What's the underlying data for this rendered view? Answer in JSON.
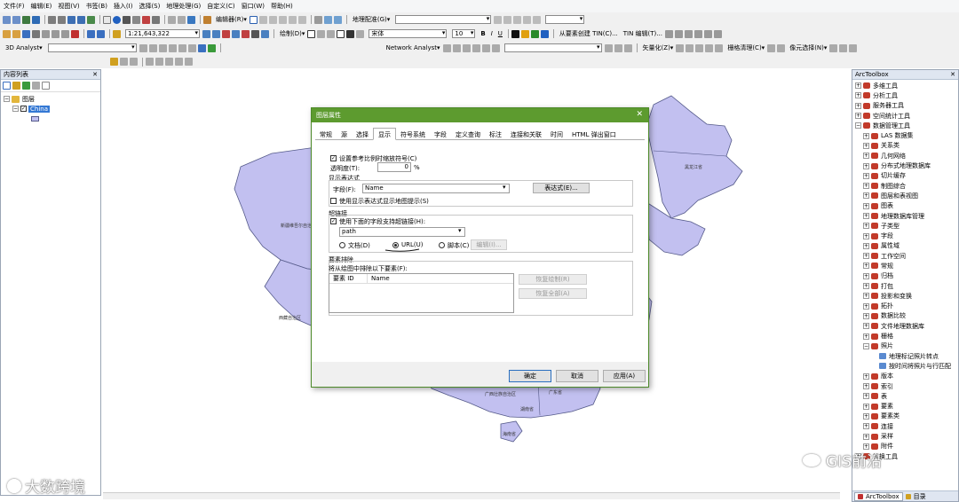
{
  "menu": [
    "文件(F)",
    "编辑(E)",
    "视图(V)",
    "书签(B)",
    "插入(I)",
    "选择(S)",
    "地理处理(G)",
    "自定义(C)",
    "窗口(W)",
    "帮助(H)"
  ],
  "toolbar1": {
    "editor_label": "编辑器(R)▾",
    "georef_label": "地理配准(G)▾"
  },
  "toolbar2": {
    "scale": "1:21,643,322",
    "draw_label": "绘制(D)▾",
    "font": "宋体",
    "font_size": "10",
    "bold": "B",
    "italic": "I",
    "underline": "U",
    "tin_from_features": "从要素创建 TIN(C)...",
    "tin_editing": "TIN 编辑(T)..."
  },
  "toolbar3": {
    "analyst_3d": "3D Analyst▾",
    "network_analyst": "Network Analyst▾",
    "vectorize": "矢量化(Z)▾",
    "raster_cleanup": "栅格清理(C)▾",
    "cell_select": "像元选择(N)▾"
  },
  "toc": {
    "title": "内容列表",
    "layers_label": "图层",
    "layer_name": "China"
  },
  "toolbox": {
    "title": "ArcToolbox",
    "items": [
      {
        "label": "多维工具",
        "level": 0,
        "exp": "+"
      },
      {
        "label": "分析工具",
        "level": 0,
        "exp": "+"
      },
      {
        "label": "服务器工具",
        "level": 0,
        "exp": "+"
      },
      {
        "label": "空间统计工具",
        "level": 0,
        "exp": "+"
      },
      {
        "label": "数据管理工具",
        "level": 0,
        "exp": "-"
      },
      {
        "label": "LAS 数据集",
        "level": 1,
        "exp": "+"
      },
      {
        "label": "关系类",
        "level": 1,
        "exp": "+"
      },
      {
        "label": "几何网络",
        "level": 1,
        "exp": "+"
      },
      {
        "label": "分布式地理数据库",
        "level": 1,
        "exp": "+"
      },
      {
        "label": "切片缓存",
        "level": 1,
        "exp": "+"
      },
      {
        "label": "制图综合",
        "level": 1,
        "exp": "+"
      },
      {
        "label": "图层和表视图",
        "level": 1,
        "exp": "+"
      },
      {
        "label": "图表",
        "level": 1,
        "exp": "+"
      },
      {
        "label": "地理数据库管理",
        "level": 1,
        "exp": "+"
      },
      {
        "label": "子类型",
        "level": 1,
        "exp": "+"
      },
      {
        "label": "字段",
        "level": 1,
        "exp": "+"
      },
      {
        "label": "属性域",
        "level": 1,
        "exp": "+"
      },
      {
        "label": "工作空间",
        "level": 1,
        "exp": "+"
      },
      {
        "label": "常规",
        "level": 1,
        "exp": "+"
      },
      {
        "label": "归档",
        "level": 1,
        "exp": "+"
      },
      {
        "label": "打包",
        "level": 1,
        "exp": "+"
      },
      {
        "label": "投影和变换",
        "level": 1,
        "exp": "+"
      },
      {
        "label": "拓扑",
        "level": 1,
        "exp": "+"
      },
      {
        "label": "数据比较",
        "level": 1,
        "exp": "+"
      },
      {
        "label": "文件地理数据库",
        "level": 1,
        "exp": "+"
      },
      {
        "label": "栅格",
        "level": 1,
        "exp": "+"
      },
      {
        "label": "照片",
        "level": 1,
        "exp": "-"
      },
      {
        "label": "地理标记照片转点",
        "level": 2,
        "exp": ""
      },
      {
        "label": "按时间将照片与行匹配",
        "level": 2,
        "exp": ""
      },
      {
        "label": "版本",
        "level": 1,
        "exp": "+"
      },
      {
        "label": "索引",
        "level": 1,
        "exp": "+"
      },
      {
        "label": "表",
        "level": 1,
        "exp": "+"
      },
      {
        "label": "要素",
        "level": 1,
        "exp": "+"
      },
      {
        "label": "要素类",
        "level": 1,
        "exp": "+"
      },
      {
        "label": "连接",
        "level": 1,
        "exp": "+"
      },
      {
        "label": "采样",
        "level": 1,
        "exp": "+"
      },
      {
        "label": "附件",
        "level": 1,
        "exp": "+"
      },
      {
        "label": "转换工具",
        "level": 0,
        "exp": "+"
      }
    ],
    "tab_toolbox": "ArcToolbox",
    "tab_catalog": "目录"
  },
  "map_labels": [
    "黑龙江省",
    "新疆维吾尔自治区",
    "西藏自治区",
    "广东省",
    "广西壮族自治区",
    "海南省",
    "湖南省"
  ],
  "dialog": {
    "title": "图层属性",
    "close": "✕",
    "tabs": [
      "常规",
      "源",
      "选择",
      "显示",
      "符号系统",
      "字段",
      "定义查询",
      "标注",
      "连接和关联",
      "时间",
      "HTML 弹出窗口"
    ],
    "active_tab": "显示",
    "scale_symbols": "设置参考比例时缩放符号(C)",
    "transparency_label": "透明度(T):",
    "transparency_value": "0",
    "percent": "%",
    "display_expr_group": "显示表达式",
    "field_label": "字段(F):",
    "field_value": "Name",
    "expression_btn": "表达式(E)...",
    "use_expr_tips": "使用显示表达式显示地图提示(S)",
    "hyperlinks_group": "超链接",
    "use_field_hyperlink": "使用下面的字段支持超链接(H):",
    "hyperlink_field": "path",
    "radio_document": "文档(D)",
    "radio_url": "URL(U)",
    "radio_script": "脚本(C)",
    "edit_btn": "编辑(I)...",
    "feature_exclusion_group": "要素排除",
    "exclude_text": "将从绘图中排除以下要素(F):",
    "col_feature_id": "要素 ID",
    "col_name": "Name",
    "restore_draw_btn": "恢复绘制(R)",
    "restore_all_btn": "恢复全部(A)",
    "ok": "确定",
    "cancel": "取消",
    "apply": "应用(A)"
  },
  "watermark_left": "大数跨境",
  "watermark_right": "GIS前沿",
  "colors": {
    "map_fill": "#c2c0f0",
    "map_stroke": "#555a8a",
    "dialog_title": "#5d9b2f",
    "pane_title": "#dfe6f1"
  }
}
